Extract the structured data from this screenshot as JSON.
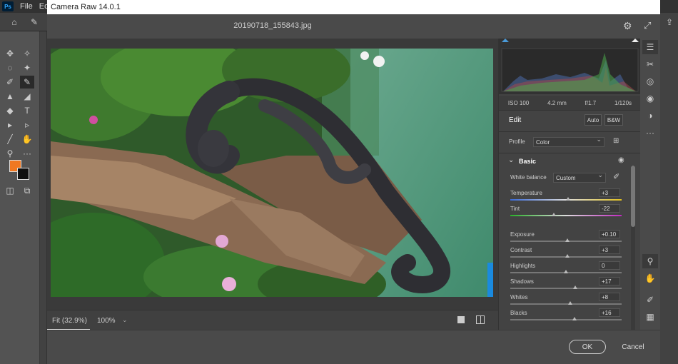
{
  "ps": {
    "menu": [
      "File",
      "Edit"
    ],
    "logo": "Ps"
  },
  "dialog": {
    "title": "Camera Raw 14.0.1",
    "filename": "20190718_155843.jpg",
    "zoom_fit": "Fit (32.9%)",
    "zoom_100": "100%",
    "ok": "OK",
    "cancel": "Cancel"
  },
  "panel": {
    "meta": {
      "iso": "ISO 100",
      "focal": "4.2 mm",
      "aperture": "f/1.7",
      "shutter": "1/120s"
    },
    "edit_label": "Edit",
    "auto_label": "Auto",
    "bw_label": "B&W",
    "profile_label": "Profile",
    "profile_value": "Color",
    "basic_label": "Basic",
    "wb_label": "White balance",
    "wb_value": "Custom",
    "sliders": [
      {
        "label": "Temperature",
        "value": "+3",
        "pos": 0.52
      },
      {
        "label": "Tint",
        "value": "-22",
        "pos": 0.39
      },
      {
        "label": "Exposure",
        "value": "+0.10",
        "pos": 0.51
      },
      {
        "label": "Contrast",
        "value": "+3",
        "pos": 0.51
      },
      {
        "label": "Highlights",
        "value": "0",
        "pos": 0.5
      },
      {
        "label": "Shadows",
        "value": "+17",
        "pos": 0.585
      },
      {
        "label": "Whites",
        "value": "+8",
        "pos": 0.54
      },
      {
        "label": "Blacks",
        "value": "+16",
        "pos": 0.58
      }
    ]
  },
  "colors": {
    "foreground": "#f07822",
    "background": "#111111"
  }
}
